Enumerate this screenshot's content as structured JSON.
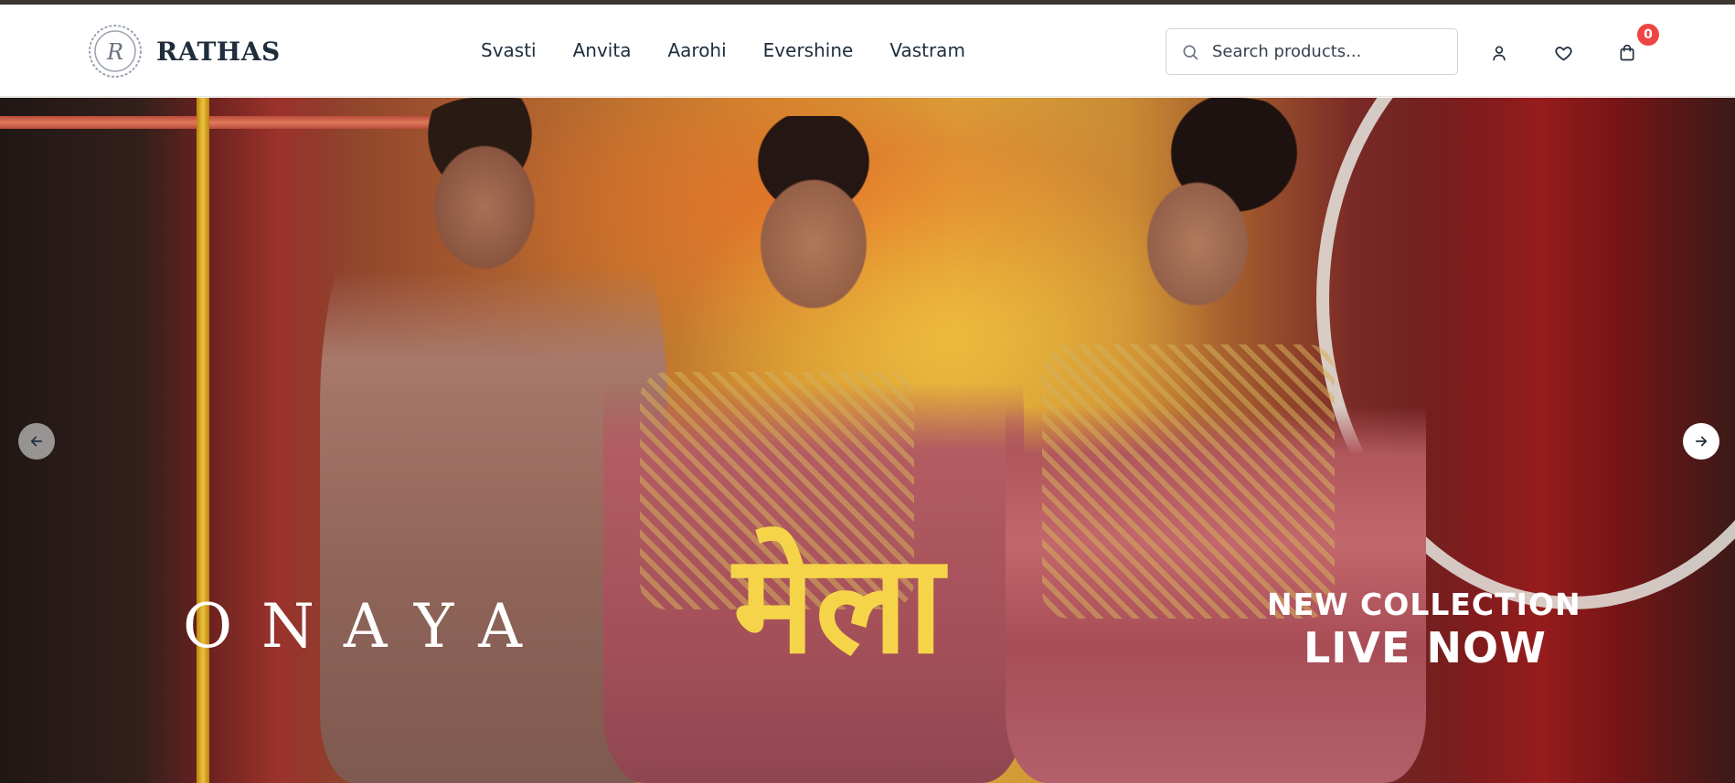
{
  "brand": {
    "name": "RATHAS",
    "logo_letter": "R"
  },
  "nav": {
    "items": [
      {
        "label": "Svasti"
      },
      {
        "label": "Anvita"
      },
      {
        "label": "Aarohi"
      },
      {
        "label": "Evershine"
      },
      {
        "label": "Vastram"
      }
    ]
  },
  "search": {
    "placeholder": "Search products...",
    "value": ""
  },
  "header_icons": {
    "account": "user-icon",
    "wishlist": "heart-icon",
    "cart": "shopping-bag-icon"
  },
  "cart": {
    "count": "0"
  },
  "colors": {
    "accent_badge": "#ef4444",
    "brand_text": "#1f2d3d",
    "hero_yellow": "#f6d44a"
  },
  "hero": {
    "brand_word": "ONAYA",
    "collection_title": "मेला",
    "tagline_top": "NEW COLLECTION",
    "tagline_bottom": "LIVE NOW",
    "prev_icon": "arrow-left-icon",
    "next_icon": "arrow-right-icon"
  }
}
